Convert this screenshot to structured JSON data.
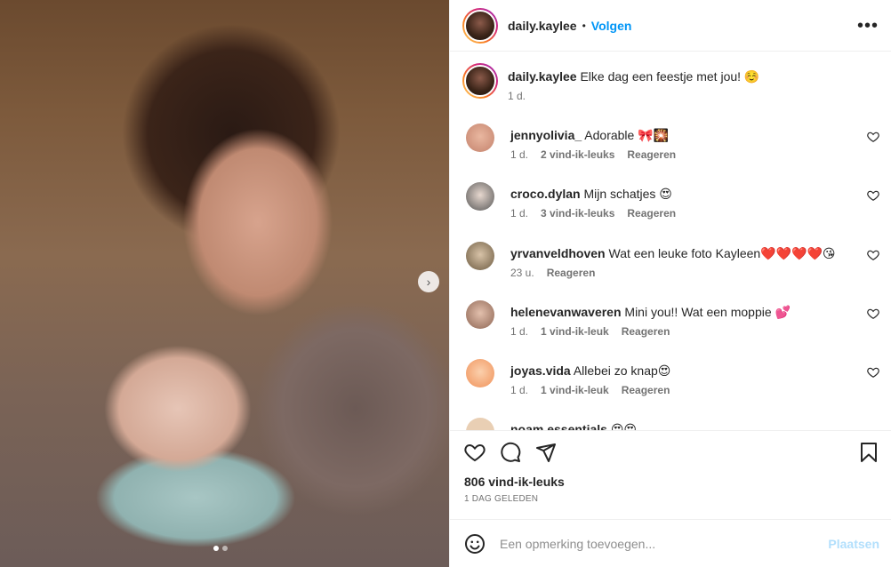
{
  "post": {
    "username": "daily.kaylee",
    "follow_label": "Volgen",
    "separator": "•",
    "more_icon": "more-horizontal-icon",
    "photo_next_icon": "chevron-right-icon"
  },
  "caption": {
    "username": "daily.kaylee",
    "text": "Elke dag een feestje met jou! ☺️",
    "time": "1 d."
  },
  "comments": [
    {
      "username": "jennyolivia_",
      "text": "Adorable 🎀🎇",
      "time": "1 d.",
      "likes": "2 vind-ik-leuks",
      "reply": "Reageren",
      "avatar_color": "#d9a28e"
    },
    {
      "username": "croco.dylan",
      "text": "Mijn schatjes 😍",
      "time": "1 d.",
      "likes": "3 vind-ik-leuks",
      "reply": "Reageren",
      "avatar_color": "#6b6b6b"
    },
    {
      "username": "yrvanveldhoven",
      "text": "Wat een leuke foto Kayleen❤️❤️❤️❤️😘",
      "time": "23 u.",
      "likes": "",
      "reply": "Reageren",
      "avatar_color": "#7a6a52"
    },
    {
      "username": "helenevanwaveren",
      "text": "Mini you!! Wat een moppie 💕",
      "time": "1 d.",
      "likes": "1 vind-ik-leuk",
      "reply": "Reageren",
      "avatar_color": "#b58a76"
    },
    {
      "username": "joyas.vida",
      "text": "Allebei zo knap😍",
      "time": "1 d.",
      "likes": "1 vind-ik-leuk",
      "reply": "Reageren",
      "avatar_color": "#f2a36b"
    },
    {
      "username": "noam.essentials",
      "text": "😍😍",
      "time": "",
      "likes": "",
      "reply": "",
      "avatar_color": "#e9cfb4"
    }
  ],
  "actions": {
    "likes_count": "806 vind-ik-leuks",
    "date": "1 DAG GELEDEN"
  },
  "add_comment": {
    "placeholder": "Een opmerking toevoegen...",
    "post_label": "Plaatsen"
  },
  "colors": {
    "accent": "#0095f6",
    "post_disabled": "#b2dffc",
    "meta_gray": "#737373"
  }
}
